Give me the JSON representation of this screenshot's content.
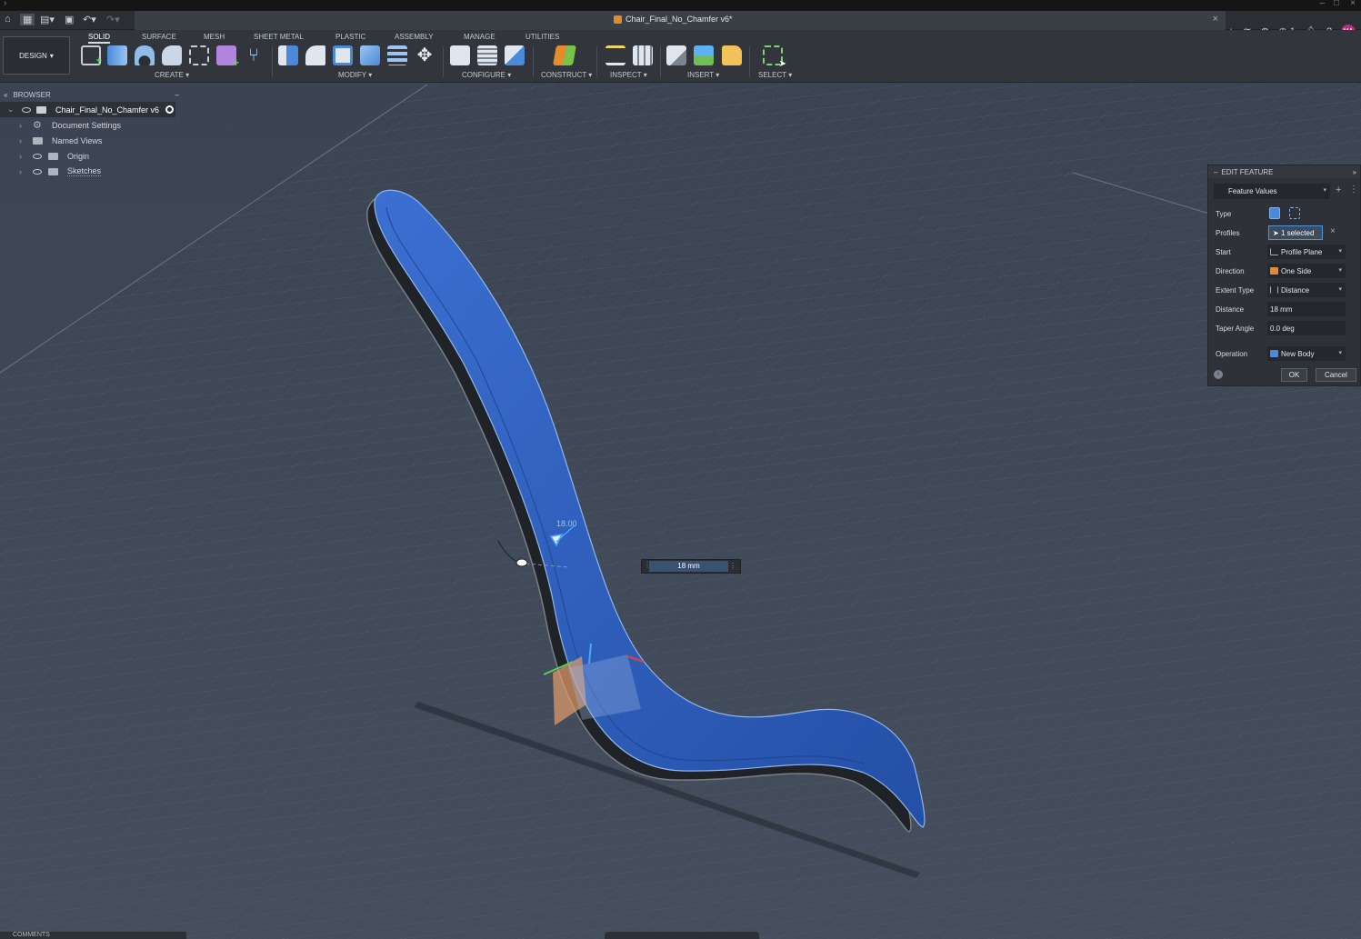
{
  "app": {
    "document_title": "Chair_Final_No_Chamfer v6*",
    "user_initials": "MA",
    "job_count": "1"
  },
  "toolbar": {
    "workspace": "DESIGN",
    "tabs": [
      "SOLID",
      "SURFACE",
      "MESH",
      "SHEET METAL",
      "PLASTIC",
      "ASSEMBLY",
      "MANAGE",
      "UTILITIES"
    ],
    "active_tab": "SOLID",
    "groups": {
      "create": "CREATE",
      "modify": "MODIFY",
      "configure": "CONFIGURE",
      "construct": "CONSTRUCT",
      "inspect": "INSPECT",
      "insert": "INSERT",
      "select": "SELECT"
    }
  },
  "browser": {
    "title": "BROWSER",
    "root": "Chair_Final_No_Chamfer v6",
    "items": [
      "Document Settings",
      "Named Views",
      "Origin",
      "Sketches"
    ]
  },
  "edit_feature": {
    "title": "EDIT FEATURE",
    "values_dropdown": "Feature Values",
    "type_label": "Type",
    "profiles_label": "Profiles",
    "profiles_value": "1 selected",
    "start_label": "Start",
    "start_value": "Profile Plane",
    "direction_label": "Direction",
    "direction_value": "One Side",
    "extent_label": "Extent Type",
    "extent_value": "Distance",
    "distance_label": "Distance",
    "distance_value": "18 mm",
    "taper_label": "Taper Angle",
    "taper_value": "0.0 deg",
    "operation_label": "Operation",
    "operation_value": "New Body",
    "ok": "OK",
    "cancel": "Cancel"
  },
  "viewport": {
    "dimension_input": "18 mm",
    "dimension_label": "18.00"
  },
  "bottom": {
    "comments": "COMMENTS"
  },
  "colors": {
    "accent": "#4e94d6",
    "body_fill": "#2d5fb8",
    "grid_bg": "#3c4656",
    "user_badge": "#b2307c"
  }
}
